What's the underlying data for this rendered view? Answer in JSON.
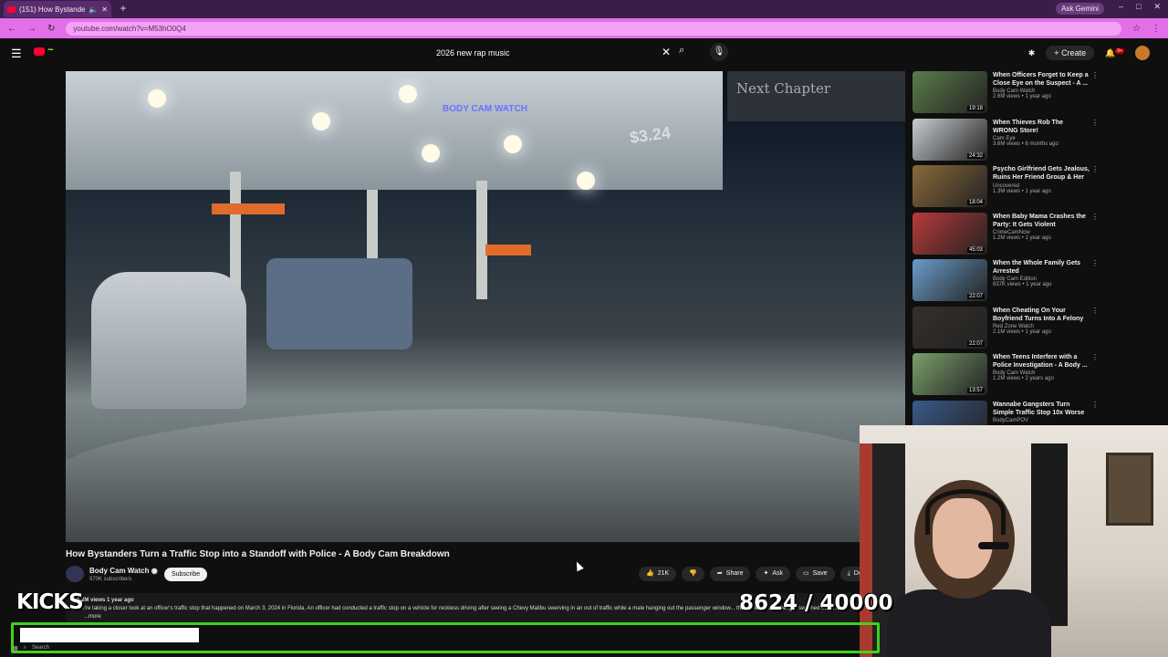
{
  "browser": {
    "tab_title": "(151) How Bystanders Turn...",
    "url": "youtube.com/watch?v=M53hO0Q4",
    "gemini": "Ask Gemini",
    "window_controls": [
      "–",
      "□",
      "✕"
    ]
  },
  "youtube": {
    "search_value": "2026 new rap music",
    "create_label": "Create",
    "notif_badge": "9+"
  },
  "player": {
    "watermark": "BODY CAM WATCH",
    "sign_text": "Next Chapter",
    "price_text": "$3.24"
  },
  "video": {
    "title": "How Bystanders Turn a Traffic Stop into a Standoff with Police - A Body Cam Breakdown",
    "channel": "Body Cam Watch",
    "subscribers": "970K subscribers",
    "subscribe_label": "Subscribe",
    "likes": "21K",
    "share_label": "Share",
    "ask_label": "Ask",
    "save_label": "Save",
    "download_label": "Dow",
    "description_meta": "1.2M views  1 year ago",
    "description": "We're taking a closer look at an officer's traffic stop that happened on March 3, 2024 in Florida. An officer had conducted a traffic stop on a vehicle for reckless driving after seeing a Chevy Malibu swerving in an out of traffic while a male hanging out the passenger window... the driver and passenger switched seats...",
    "more_label": "...more"
  },
  "recommendations": [
    {
      "title": "When Officers Forget to Keep a Close Eye on the Suspect - A ...",
      "channel": "Body Cam Watch",
      "meta": "2.6M views • 1 year ago",
      "duration": "19:18"
    },
    {
      "title": "When Thieves Rob The WRONG Store!",
      "channel": "Cam Eye",
      "meta": "3.6M views • 6 months ago",
      "duration": "24:32"
    },
    {
      "title": "Psycho Girlfriend Gets Jealous, Ruins Her Friend Group & Her ...",
      "channel": "Uncovered",
      "meta": "1.3M views • 1 year ago",
      "duration": "18:04"
    },
    {
      "title": "When Baby Mama Crashes the Party: It Gets Violent",
      "channel": "CrimeCamNow",
      "meta": "1.2M views • 1 year ago",
      "duration": "45:03"
    },
    {
      "title": "When the Whole Family Gets Arrested",
      "channel": "Body Cam Edition",
      "meta": "837K views • 1 year ago",
      "duration": "22:07"
    },
    {
      "title": "When Cheating On Your Boyfriend Turns Into A Felony",
      "channel": "Red Zone Watch",
      "meta": "2.1M views • 1 year ago",
      "duration": "22:07"
    },
    {
      "title": "When Teens Interfere with a Police Investigation - A Body ...",
      "channel": "Body Cam Watch",
      "meta": "1.2M views • 2 years ago",
      "duration": "13:57"
    },
    {
      "title": "Wannabe Gangsters Turn Simple Traffic Stop 10x Worse",
      "channel": "BodyCamPOV",
      "meta": "",
      "duration": ""
    }
  ],
  "overlay": {
    "kicks_label": "KICKS",
    "counter": "8624 / 40000",
    "progress_fraction": 0.2156,
    "progress_color": "#3fd21a"
  },
  "taskbar": {
    "search": "Search"
  }
}
